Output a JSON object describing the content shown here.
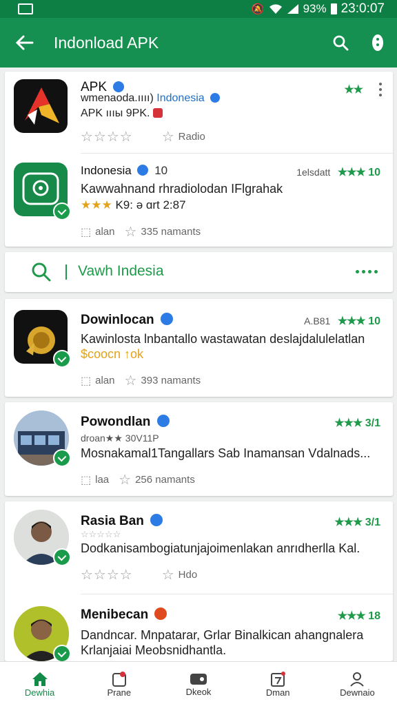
{
  "status_bar": {
    "battery": "93%",
    "time": "23:0:07"
  },
  "app_bar": {
    "title": "Indonload APK"
  },
  "cards": [
    {
      "name": "APK",
      "line1_a": "wmenaodа.ıııı)",
      "line1_b": "Indonesia",
      "line2": "APK  ıııы 9PK.",
      "rating_stars": "★★",
      "meta_right": "Radio"
    },
    {
      "name": "Indonesia",
      "name_suffix": "10",
      "rating_prefix": "1elsdatt",
      "rating_stars": "★★★",
      "rating_value": "10",
      "line1": "Kawwahnand rhradiolodan IFlgrahak",
      "line2": "K9: ə ɑrt 2:87",
      "meta_left": "alan",
      "meta_right": "335 namants"
    }
  ],
  "search_bar": {
    "text": "Vawh Indesia"
  },
  "list": [
    {
      "name": "Dowinlocan",
      "rating_prefix": "A.B81",
      "rating_stars": "★★★",
      "rating_value": "10",
      "line1": "Kawinlosta lnbantallo wastawatan deslajdalulelatlan",
      "line2": "$coocn ↑ok",
      "meta_left": "alan",
      "meta_right": "393 namants"
    },
    {
      "name": "Powondlan",
      "rating_stars": "★★★",
      "rating_value": "3/1",
      "subline": "droan★★ 30V11P",
      "line1": "Mosnakamal1Tangallars Sab Inamansan Vdalnads...",
      "meta_left": "laa",
      "meta_right": "256 namants"
    },
    {
      "name": "Rasia Ban",
      "rating_stars": "★★★",
      "rating_value": "3/1",
      "line1": "Dodkanisambogiatunjajoimenlakan anrıdherlla Kal.",
      "meta_right": "Hdo"
    },
    {
      "name": "Menibecan",
      "rating_stars": "★★★",
      "rating_value": "18",
      "line1": "Dandncar. Mnpatarar, Grlar Binalkican ahangnalera",
      "line2": "Krlanjaiai Meobsnidhantla."
    }
  ],
  "bottom_nav": [
    {
      "label": "Dewhia",
      "icon": "home-icon"
    },
    {
      "label": "Prane",
      "icon": "notification-icon"
    },
    {
      "label": "Dkeok",
      "icon": "game-icon"
    },
    {
      "label": "Dman",
      "icon": "calendar-icon"
    },
    {
      "label": "Dewnaio",
      "icon": "profile-icon"
    }
  ],
  "colors": {
    "primary": "#159050",
    "primary_dark": "#0e7f44",
    "star_green": "#1e9a4a",
    "gold": "#e3a21a",
    "link_blue": "#1f6fc5"
  }
}
